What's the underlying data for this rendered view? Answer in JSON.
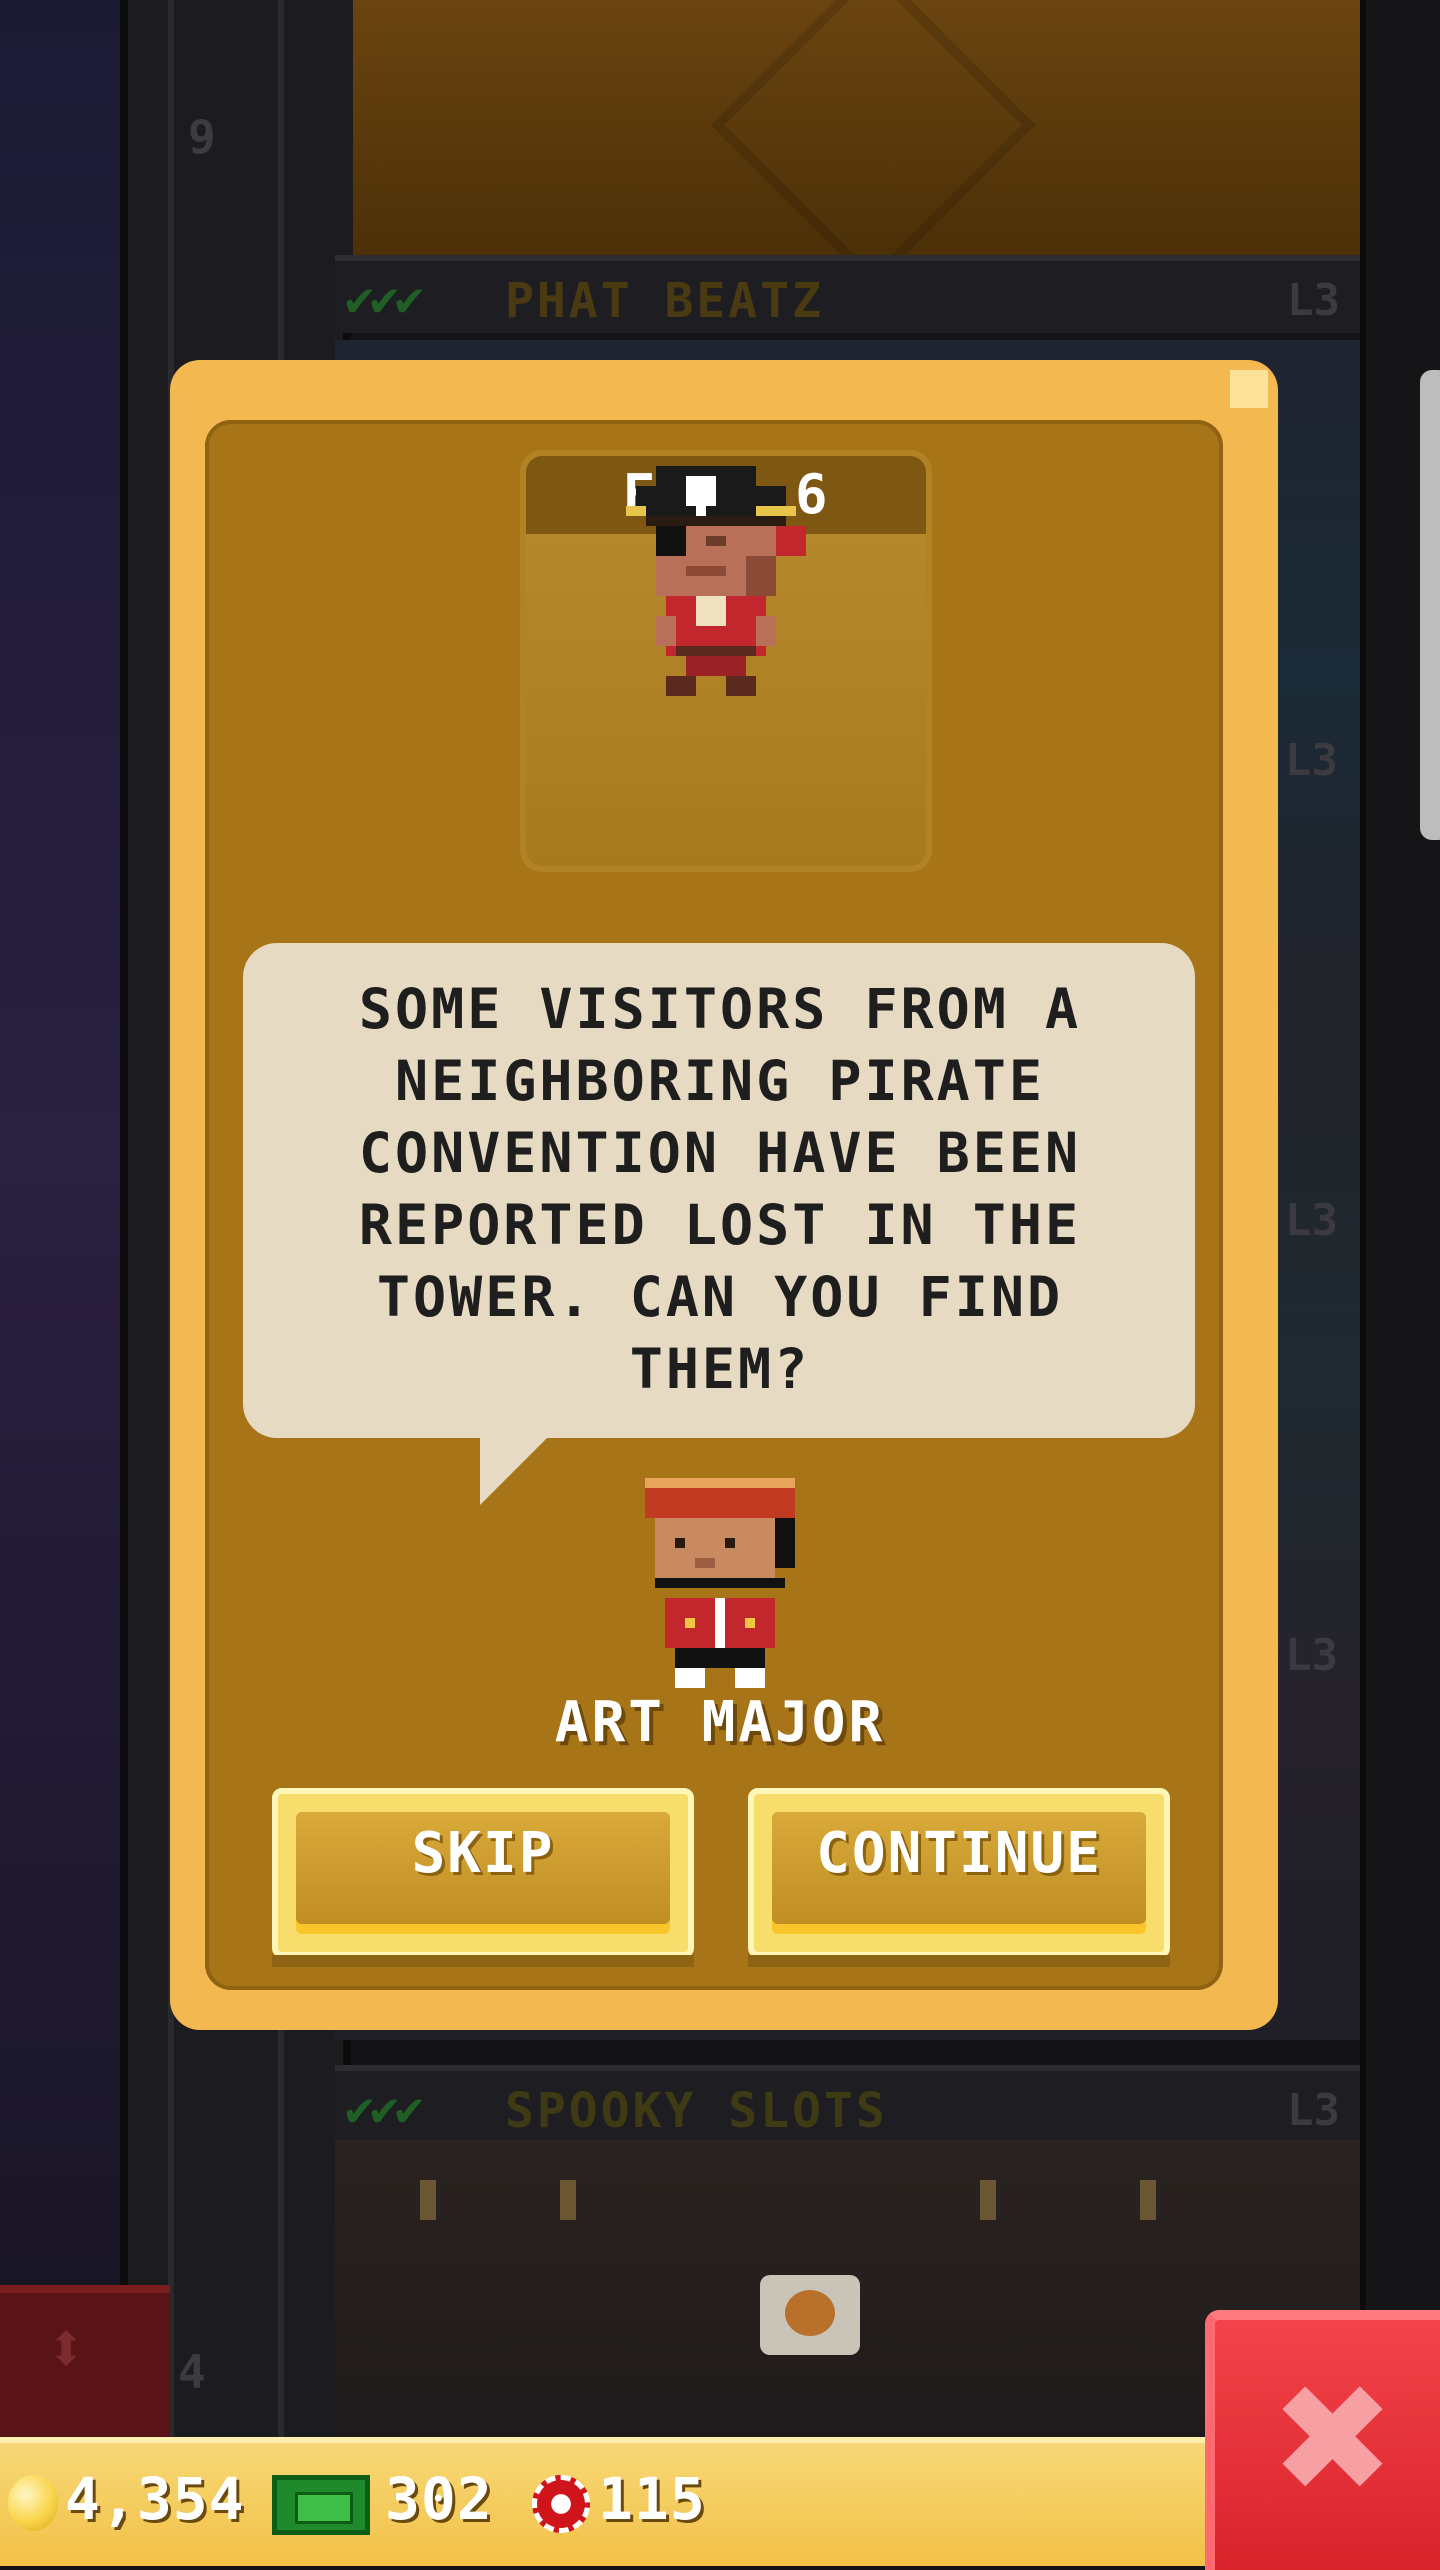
{
  "background": {
    "floor_numbers": [
      "9",
      "4"
    ],
    "rooms": [
      {
        "name": "PHAT BEATZ",
        "level": "L3",
        "checks": "✔✔✔",
        "title_color": "#4a3a12"
      },
      {
        "name": "SPOOKY SLOTS",
        "level": "L3",
        "checks": "✔✔✔",
        "title_color": "#3d3a14"
      }
    ],
    "side_levels": [
      "L3",
      "L3",
      "L3"
    ]
  },
  "mission": {
    "portrait_icon": "pirate-visitor-icon",
    "objective": "FIND 6",
    "message": "SOME VISITORS FROM A\nNEIGHBORING PIRATE\nCONVENTION HAVE BEEN\nREPORTED LOST IN THE\nTOWER. CAN YOU FIND\nTHEM?",
    "npc_icon": "bellhop-bitizen-icon",
    "npc_name": "ART MAJOR",
    "skip_label": "SKIP",
    "continue_label": "CONTINUE"
  },
  "currency": {
    "coins": "4,354",
    "coin_icon": "coin-icon",
    "bux": "302",
    "bux_icon": "tower-bux-icon",
    "chips": "115",
    "chip_icon": "poker-chip-icon"
  },
  "close_icon": "close-x-icon",
  "colors": {
    "modal_outer": "#f4b851",
    "modal_inner": "#a77517",
    "bubble": "#e6dac2",
    "close_button": "#e0262e"
  }
}
